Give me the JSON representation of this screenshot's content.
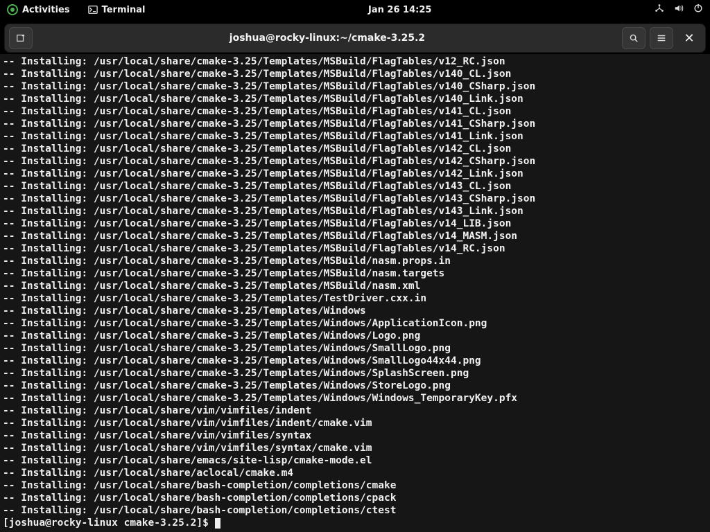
{
  "topbar": {
    "activities": "Activities",
    "terminal_label": "Terminal",
    "clock": "Jan 26  14:25"
  },
  "headerbar": {
    "title": "joshua@rocky-linux:~/cmake-3.25.2"
  },
  "terminal": {
    "install_prefix": "-- Installing: ",
    "lines": [
      "/usr/local/share/cmake-3.25/Templates/MSBuild/FlagTables/v12_RC.json",
      "/usr/local/share/cmake-3.25/Templates/MSBuild/FlagTables/v140_CL.json",
      "/usr/local/share/cmake-3.25/Templates/MSBuild/FlagTables/v140_CSharp.json",
      "/usr/local/share/cmake-3.25/Templates/MSBuild/FlagTables/v140_Link.json",
      "/usr/local/share/cmake-3.25/Templates/MSBuild/FlagTables/v141_CL.json",
      "/usr/local/share/cmake-3.25/Templates/MSBuild/FlagTables/v141_CSharp.json",
      "/usr/local/share/cmake-3.25/Templates/MSBuild/FlagTables/v141_Link.json",
      "/usr/local/share/cmake-3.25/Templates/MSBuild/FlagTables/v142_CL.json",
      "/usr/local/share/cmake-3.25/Templates/MSBuild/FlagTables/v142_CSharp.json",
      "/usr/local/share/cmake-3.25/Templates/MSBuild/FlagTables/v142_Link.json",
      "/usr/local/share/cmake-3.25/Templates/MSBuild/FlagTables/v143_CL.json",
      "/usr/local/share/cmake-3.25/Templates/MSBuild/FlagTables/v143_CSharp.json",
      "/usr/local/share/cmake-3.25/Templates/MSBuild/FlagTables/v143_Link.json",
      "/usr/local/share/cmake-3.25/Templates/MSBuild/FlagTables/v14_LIB.json",
      "/usr/local/share/cmake-3.25/Templates/MSBuild/FlagTables/v14_MASM.json",
      "/usr/local/share/cmake-3.25/Templates/MSBuild/FlagTables/v14_RC.json",
      "/usr/local/share/cmake-3.25/Templates/MSBuild/nasm.props.in",
      "/usr/local/share/cmake-3.25/Templates/MSBuild/nasm.targets",
      "/usr/local/share/cmake-3.25/Templates/MSBuild/nasm.xml",
      "/usr/local/share/cmake-3.25/Templates/TestDriver.cxx.in",
      "/usr/local/share/cmake-3.25/Templates/Windows",
      "/usr/local/share/cmake-3.25/Templates/Windows/ApplicationIcon.png",
      "/usr/local/share/cmake-3.25/Templates/Windows/Logo.png",
      "/usr/local/share/cmake-3.25/Templates/Windows/SmallLogo.png",
      "/usr/local/share/cmake-3.25/Templates/Windows/SmallLogo44x44.png",
      "/usr/local/share/cmake-3.25/Templates/Windows/SplashScreen.png",
      "/usr/local/share/cmake-3.25/Templates/Windows/StoreLogo.png",
      "/usr/local/share/cmake-3.25/Templates/Windows/Windows_TemporaryKey.pfx",
      "/usr/local/share/vim/vimfiles/indent",
      "/usr/local/share/vim/vimfiles/indent/cmake.vim",
      "/usr/local/share/vim/vimfiles/syntax",
      "/usr/local/share/vim/vimfiles/syntax/cmake.vim",
      "/usr/local/share/emacs/site-lisp/cmake-mode.el",
      "/usr/local/share/aclocal/cmake.m4",
      "/usr/local/share/bash-completion/completions/cmake",
      "/usr/local/share/bash-completion/completions/cpack",
      "/usr/local/share/bash-completion/completions/ctest"
    ],
    "prompt": "[joshua@rocky-linux cmake-3.25.2]$ "
  }
}
